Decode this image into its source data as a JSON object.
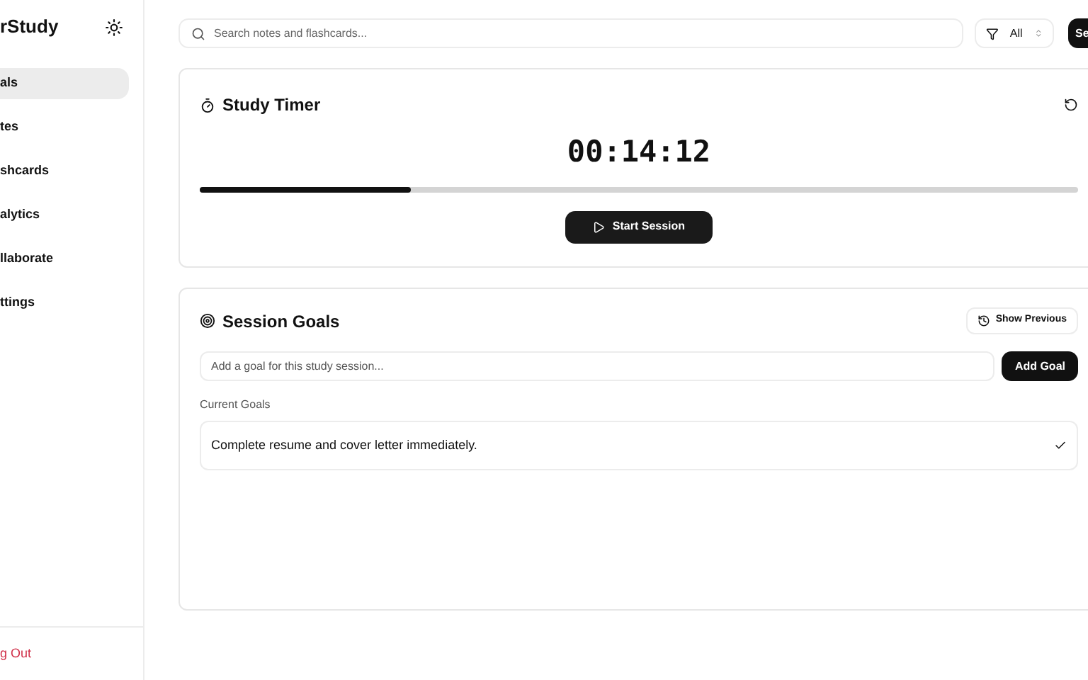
{
  "sidebar": {
    "brand": "rStudy",
    "items": [
      {
        "label": "als",
        "selected": true
      },
      {
        "label": "tes",
        "selected": false
      },
      {
        "label": "shcards",
        "selected": false
      },
      {
        "label": "alytics",
        "selected": false
      },
      {
        "label": "llaborate",
        "selected": false
      },
      {
        "label": "ttings",
        "selected": false
      }
    ],
    "logout": "g Out"
  },
  "search": {
    "placeholder": "Search notes and flashcards...",
    "filter": "All",
    "button": "Se"
  },
  "timer": {
    "title": "Study Timer",
    "time": "00:14:12",
    "level": 0.24,
    "button": "Start Session"
  },
  "goals": {
    "title": "Session Goals",
    "history_button": "Show Previous",
    "input_placeholder": "Add a goal for this study session...",
    "add_button": "Add Goal",
    "section_label": "Current Goals",
    "items": [
      {
        "text": "Complete resume and cover letter immediately.",
        "done": true
      }
    ]
  }
}
